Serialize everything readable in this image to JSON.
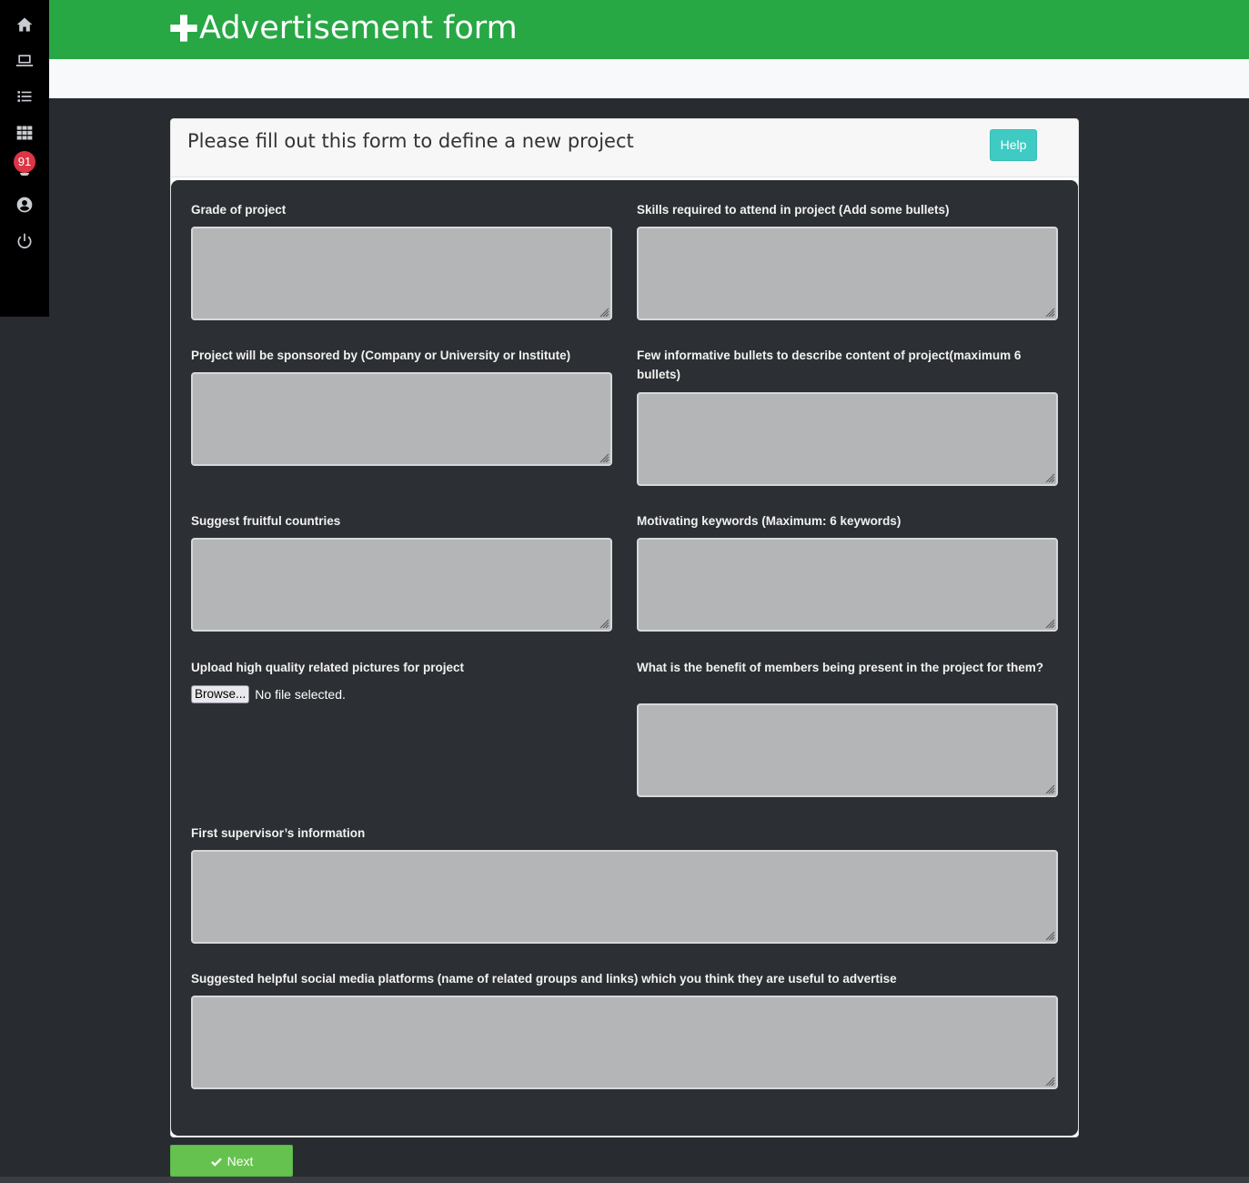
{
  "header": {
    "title": "Advertisement form"
  },
  "sidebar": {
    "items": [
      {
        "icon": "home-icon"
      },
      {
        "icon": "laptop-icon"
      },
      {
        "icon": "list-icon"
      },
      {
        "icon": "grid-icon"
      },
      {
        "icon": "bell-icon",
        "badge": "91"
      },
      {
        "icon": "user-icon"
      },
      {
        "icon": "power-icon"
      }
    ]
  },
  "card": {
    "heading": "Please fill out this form to define a new project",
    "help_label": "Help"
  },
  "form": {
    "grade_label": "Grade of project",
    "skills_label": "Skills required to attend in project (Add some bullets)",
    "sponsor_label": "Project will be sponsored by (Company or University or Institute)",
    "bullets_label": "Few informative bullets to describe content of project(maximum 6 bullets)",
    "countries_label": "Suggest fruitful countries",
    "keywords_label": "Motivating keywords (Maximum: 6 keywords)",
    "upload_label": "Upload high quality related pictures for project",
    "browse_label": "Browse...",
    "file_status": "No file selected.",
    "benefit_label": "What is the benefit of members being present in the project for them?",
    "supervisor_label": "First supervisor’s information",
    "social_label": "Suggested helpful social media platforms (name of related groups and links) which you think they are useful to advertise"
  },
  "actions": {
    "next_label": "Next"
  },
  "colors": {
    "header_green": "#28a745",
    "help_teal": "#3fcbc3",
    "next_green": "#66c24f",
    "badge_red": "#dc3545",
    "body_dark": "#282b30"
  }
}
